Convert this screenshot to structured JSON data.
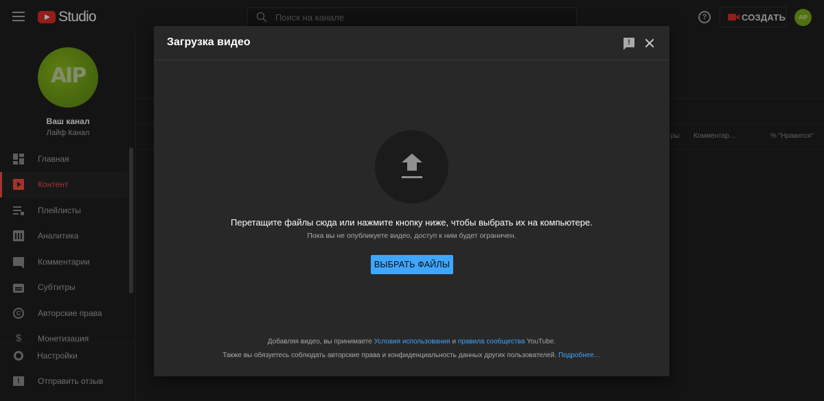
{
  "app": {
    "logo_text": "Studio"
  },
  "search": {
    "placeholder": "Поиск на канале"
  },
  "header": {
    "create_label": "СОЗДАТЬ",
    "avatar_text": "AIP"
  },
  "channel": {
    "avatar_text": "AIP",
    "title": "Ваш канал",
    "name": "Лайф Канал"
  },
  "sidebar": {
    "items": [
      {
        "label": "Главная",
        "icon": "dashboard-icon"
      },
      {
        "label": "Контент",
        "icon": "content-icon",
        "active": true
      },
      {
        "label": "Плейлисты",
        "icon": "playlist-icon"
      },
      {
        "label": "Аналитика",
        "icon": "analytics-icon"
      },
      {
        "label": "Комментарии",
        "icon": "comments-icon"
      },
      {
        "label": "Субтитры",
        "icon": "subtitles-icon"
      },
      {
        "label": "Авторские права",
        "icon": "copyright-icon"
      },
      {
        "label": "Монетизация",
        "icon": "monetization-icon"
      }
    ],
    "bottom": [
      {
        "label": "Настройки",
        "icon": "gear-icon"
      },
      {
        "label": "Отправить отзыв",
        "icon": "feedback-icon"
      }
    ]
  },
  "background_table": {
    "columns": [
      "тры",
      "Комментар…",
      "% \"Нравится\""
    ]
  },
  "dialog": {
    "title": "Загрузка видео",
    "drop_text": "Перетащите файлы сюда или нажмите кнопку ниже, чтобы выбрать их на компьютере.",
    "drop_subtext": "Пока вы не опубликуете видео, доступ к ним будет ограничен.",
    "select_button": "ВЫБРАТЬ ФАЙЛЫ",
    "terms": {
      "prefix": "Добавляя видео, вы принимаете ",
      "link1": "Условия использования",
      "and": " и ",
      "link2": "правила сообщества",
      "suffix": " YouTube."
    },
    "terms2": {
      "text": "Также вы обязуетесь соблюдать авторские права и конфиденциальность данных других пользователей. ",
      "link": "Подробнее…"
    }
  },
  "colors": {
    "accent": "#3ea6ff",
    "brand_red": "#e52d27",
    "active_red": "#ff4e45"
  }
}
